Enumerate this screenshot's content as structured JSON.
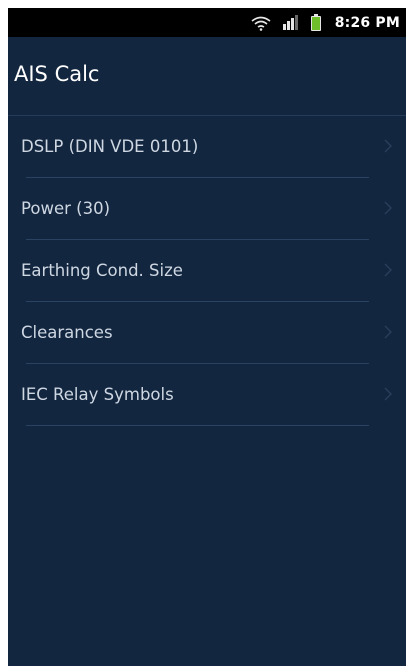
{
  "status_bar": {
    "time": "8:26 PM",
    "icons": [
      "wifi-icon",
      "signal-icon",
      "battery-icon"
    ],
    "colors": {
      "battery": "#6fbf2a",
      "icons": "#e6e6e6"
    }
  },
  "app": {
    "title": "AIS Calc",
    "background": "#13263f"
  },
  "menu": {
    "items": [
      {
        "label": "DSLP (DIN VDE 0101)"
      },
      {
        "label": "Power (30)"
      },
      {
        "label": "Earthing Cond. Size"
      },
      {
        "label": "Clearances"
      },
      {
        "label": "IEC Relay Symbols"
      }
    ],
    "trailing_icon": "chevron-right-icon"
  }
}
